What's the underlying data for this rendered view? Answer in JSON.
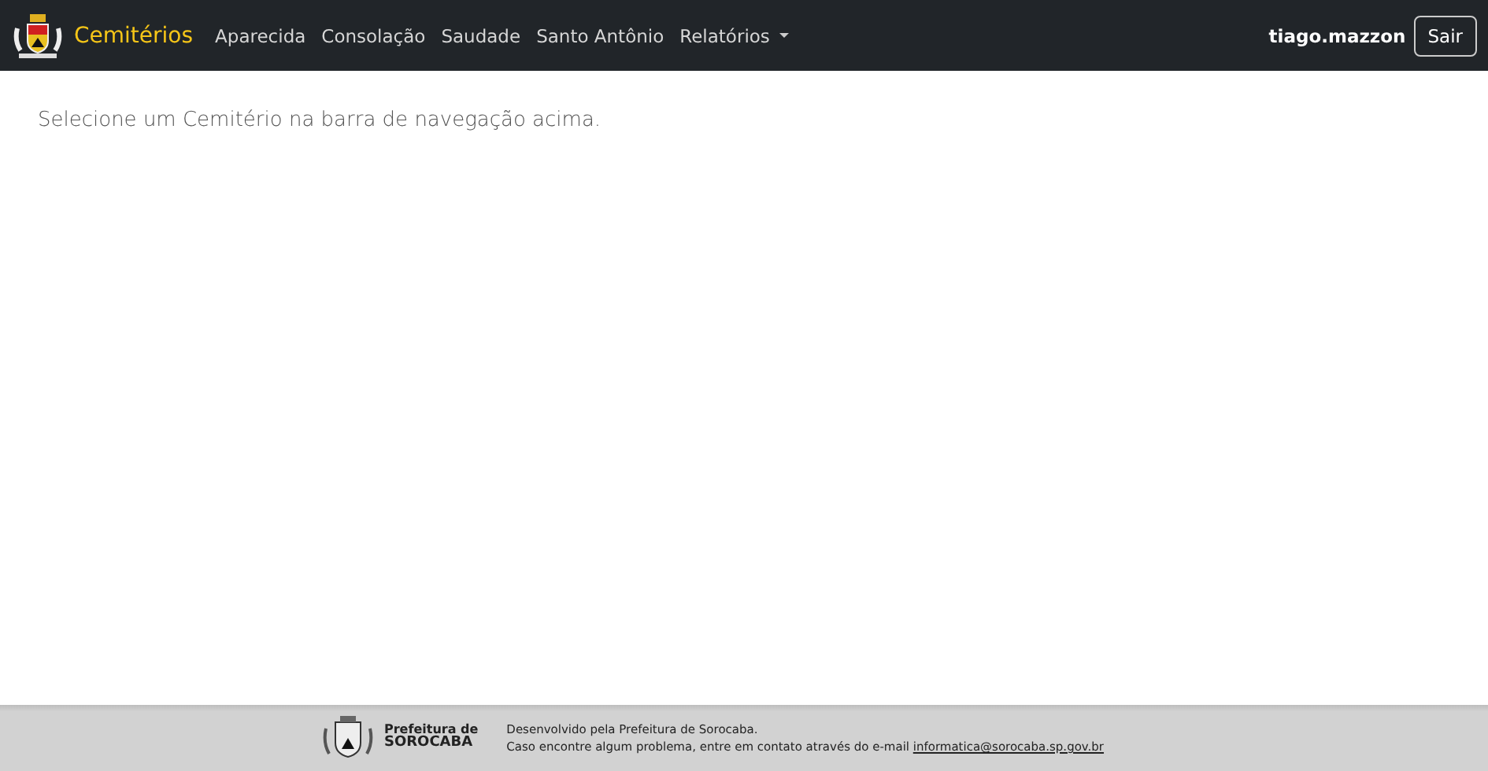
{
  "navbar": {
    "brand": "Cemitérios",
    "links": [
      {
        "label": "Aparecida",
        "kind": "link"
      },
      {
        "label": "Consolação",
        "kind": "link"
      },
      {
        "label": "Saudade",
        "kind": "link"
      },
      {
        "label": "Santo Antônio",
        "kind": "link"
      },
      {
        "label": "Relatórios",
        "kind": "dropdown"
      }
    ],
    "user": "tiago.mazzon",
    "logout": "Sair"
  },
  "main": {
    "message": "Selecione um Cemitério na barra de navegação acima."
  },
  "footer": {
    "logo_line_1": "Prefeitura de",
    "logo_line_2": "SOROCABA",
    "line_1": "Desenvolvido pela Prefeitura de Sorocaba.",
    "line_2": "Caso encontre algum problema, entre em contato através do e-mail",
    "email": "informatica@sorocaba.sp.gov.br"
  }
}
